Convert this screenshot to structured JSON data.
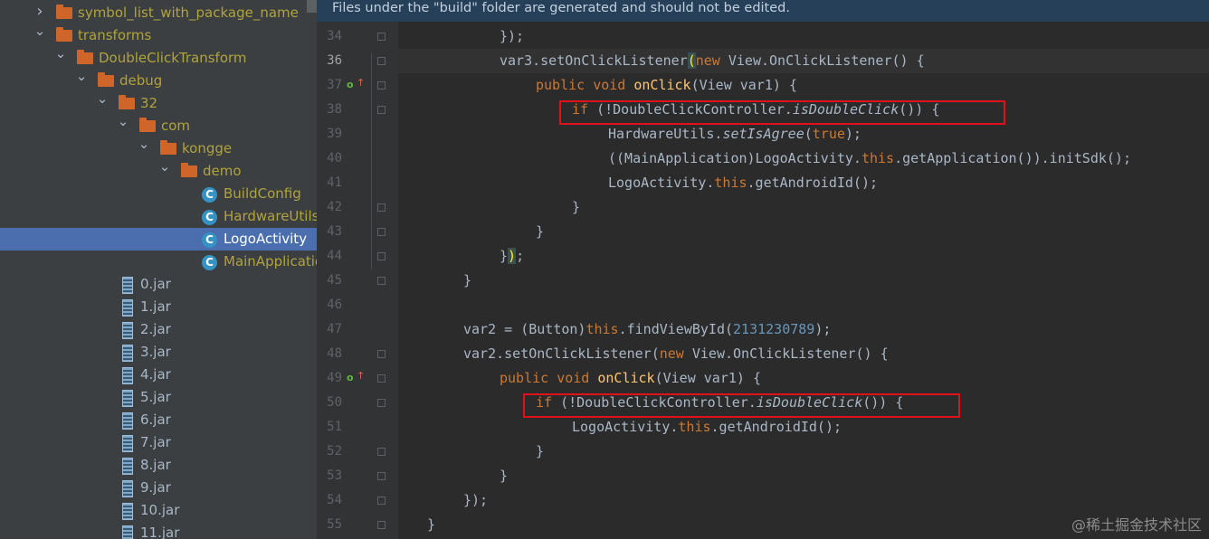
{
  "tree": {
    "items": [
      {
        "label": "symbol_list_with_package_name",
        "kind": "folder",
        "level": 0,
        "chevron": "right",
        "icon": "folder-icon"
      },
      {
        "label": "transforms",
        "kind": "folder",
        "level": 0,
        "chevron": "down",
        "icon": "folder-icon"
      },
      {
        "label": "DoubleClickTransform",
        "kind": "folder",
        "level": 1,
        "chevron": "down",
        "icon": "folder-icon"
      },
      {
        "label": "debug",
        "kind": "folder",
        "level": 2,
        "chevron": "down",
        "icon": "folder-icon"
      },
      {
        "label": "32",
        "kind": "folder",
        "level": 3,
        "chevron": "down",
        "icon": "folder-icon"
      },
      {
        "label": "com",
        "kind": "folder",
        "level": 4,
        "chevron": "down",
        "icon": "folder-icon"
      },
      {
        "label": "kongge",
        "kind": "folder",
        "level": 5,
        "chevron": "down",
        "icon": "folder-icon"
      },
      {
        "label": "demo",
        "kind": "folder",
        "level": 6,
        "chevron": "down",
        "icon": "folder-icon"
      },
      {
        "label": "BuildConfig",
        "kind": "class",
        "level": 7,
        "icon": "class-icon"
      },
      {
        "label": "HardwareUtils",
        "kind": "class",
        "level": 7,
        "icon": "class-icon"
      },
      {
        "label": "LogoActivity",
        "kind": "class",
        "level": 7,
        "icon": "class-icon",
        "selected": true
      },
      {
        "label": "MainApplication",
        "kind": "class",
        "level": 7,
        "icon": "class-icon"
      },
      {
        "label": "0.jar",
        "kind": "jar",
        "level": 5,
        "icon": "jar-icon"
      },
      {
        "label": "1.jar",
        "kind": "jar",
        "level": 5,
        "icon": "jar-icon"
      },
      {
        "label": "2.jar",
        "kind": "jar",
        "level": 5,
        "icon": "jar-icon"
      },
      {
        "label": "3.jar",
        "kind": "jar",
        "level": 5,
        "icon": "jar-icon"
      },
      {
        "label": "4.jar",
        "kind": "jar",
        "level": 5,
        "icon": "jar-icon"
      },
      {
        "label": "5.jar",
        "kind": "jar",
        "level": 5,
        "icon": "jar-icon"
      },
      {
        "label": "6.jar",
        "kind": "jar",
        "level": 5,
        "icon": "jar-icon"
      },
      {
        "label": "7.jar",
        "kind": "jar",
        "level": 5,
        "icon": "jar-icon"
      },
      {
        "label": "8.jar",
        "kind": "jar",
        "level": 5,
        "icon": "jar-icon"
      },
      {
        "label": "9.jar",
        "kind": "jar",
        "level": 5,
        "icon": "jar-icon"
      },
      {
        "label": "10.jar",
        "kind": "jar",
        "level": 5,
        "icon": "jar-icon"
      },
      {
        "label": "11.jar",
        "kind": "jar",
        "level": 5,
        "icon": "jar-icon"
      }
    ]
  },
  "editor": {
    "banner": "Files under the \"build\" folder are generated and should not be edited.",
    "current_line": "36",
    "lines": [
      {
        "num": "34",
        "indent": 28,
        "tokens": [
          [
            "p",
            "});"
          ]
        ]
      },
      {
        "num": "36",
        "indent": 28,
        "tokens": [
          [
            "p",
            "var3.setOnClickListener"
          ],
          [
            "hl",
            "("
          ],
          [
            "kw",
            "new "
          ],
          [
            "p",
            "View.OnClickListener() {"
          ]
        ]
      },
      {
        "num": "37",
        "indent": 36,
        "tokens": [
          [
            "kw",
            "public void "
          ],
          [
            "fn",
            "onClick"
          ],
          [
            "p",
            "(View var1) {"
          ]
        ],
        "marker": "override"
      },
      {
        "num": "38",
        "indent": 44,
        "tokens": [
          [
            "kw",
            "if "
          ],
          [
            "p",
            "(!DoubleClickController."
          ],
          [
            "it",
            "isDoubleClick"
          ],
          [
            "p",
            "()) {"
          ]
        ]
      },
      {
        "num": "39",
        "indent": 52,
        "tokens": [
          [
            "p",
            "HardwareUtils."
          ],
          [
            "it",
            "setIsAgree"
          ],
          [
            "p",
            "("
          ],
          [
            "kw",
            "true"
          ],
          [
            "p",
            ");"
          ]
        ]
      },
      {
        "num": "40",
        "indent": 52,
        "tokens": [
          [
            "p",
            "((MainApplication)LogoActivity."
          ],
          [
            "kw",
            "this"
          ],
          [
            "p",
            ".getApplication()).initSdk();"
          ]
        ]
      },
      {
        "num": "41",
        "indent": 52,
        "tokens": [
          [
            "p",
            "LogoActivity."
          ],
          [
            "kw",
            "this"
          ],
          [
            "p",
            ".getAndroidId();"
          ]
        ]
      },
      {
        "num": "42",
        "indent": 44,
        "tokens": [
          [
            "p",
            "}"
          ]
        ]
      },
      {
        "num": "43",
        "indent": 36,
        "tokens": [
          [
            "p",
            "}"
          ]
        ]
      },
      {
        "num": "44",
        "indent": 28,
        "tokens": [
          [
            "p",
            "}"
          ],
          [
            "hl",
            ")"
          ],
          [
            "p",
            ";"
          ]
        ]
      },
      {
        "num": "45",
        "indent": 20,
        "tokens": [
          [
            "p",
            "}"
          ]
        ]
      },
      {
        "num": "46",
        "indent": 0,
        "tokens": []
      },
      {
        "num": "47",
        "indent": 20,
        "tokens": [
          [
            "p",
            "var2 = (Button)"
          ],
          [
            "kw",
            "this"
          ],
          [
            "p",
            ".findViewById("
          ],
          [
            "num",
            "2131230789"
          ],
          [
            "p",
            ");"
          ]
        ]
      },
      {
        "num": "48",
        "indent": 20,
        "tokens": [
          [
            "p",
            "var2.setOnClickListener("
          ],
          [
            "kw",
            "new "
          ],
          [
            "p",
            "View.OnClickListener() {"
          ]
        ]
      },
      {
        "num": "49",
        "indent": 28,
        "tokens": [
          [
            "kw",
            "public void "
          ],
          [
            "fn",
            "onClick"
          ],
          [
            "p",
            "(View var1) {"
          ]
        ],
        "marker": "override"
      },
      {
        "num": "50",
        "indent": 36,
        "tokens": [
          [
            "kw",
            "if "
          ],
          [
            "p",
            "(!DoubleClickController."
          ],
          [
            "it",
            "isDoubleClick"
          ],
          [
            "p",
            "()) {"
          ]
        ]
      },
      {
        "num": "51",
        "indent": 44,
        "tokens": [
          [
            "p",
            "LogoActivity."
          ],
          [
            "kw",
            "this"
          ],
          [
            "p",
            ".getAndroidId();"
          ]
        ]
      },
      {
        "num": "52",
        "indent": 36,
        "tokens": [
          [
            "p",
            "}"
          ]
        ]
      },
      {
        "num": "53",
        "indent": 28,
        "tokens": [
          [
            "p",
            "}"
          ]
        ]
      },
      {
        "num": "54",
        "indent": 20,
        "tokens": [
          [
            "p",
            "});"
          ]
        ]
      },
      {
        "num": "55",
        "indent": 12,
        "tokens": [
          [
            "p",
            "}"
          ]
        ]
      }
    ]
  },
  "watermark": "@稀土掘金技术社区",
  "colors": {
    "keyword": "#cc7832",
    "function": "#ffc66d",
    "number": "#6897bb",
    "highlight_box": "#e0111b",
    "selection": "#4b6eaf"
  }
}
